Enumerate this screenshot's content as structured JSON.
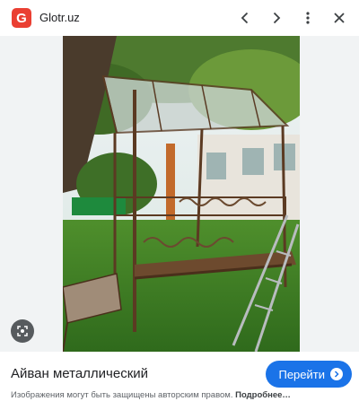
{
  "header": {
    "favicon_letter": "G",
    "site_name": "Glotr.uz"
  },
  "image": {
    "subject": "Айван металлический"
  },
  "footer": {
    "title": "Айван металлический",
    "visit_label": "Перейти",
    "copyright_note": "Изображения могут быть защищены авторским правом.",
    "more_link": "Подробнее…"
  },
  "colors": {
    "brand_red": "#ea3f32",
    "accent_blue": "#1a73e8"
  },
  "icons": [
    "back-arrow-icon",
    "forward-arrow-icon",
    "more-vert-icon",
    "close-icon",
    "lens-icon",
    "chevron-right-icon"
  ]
}
